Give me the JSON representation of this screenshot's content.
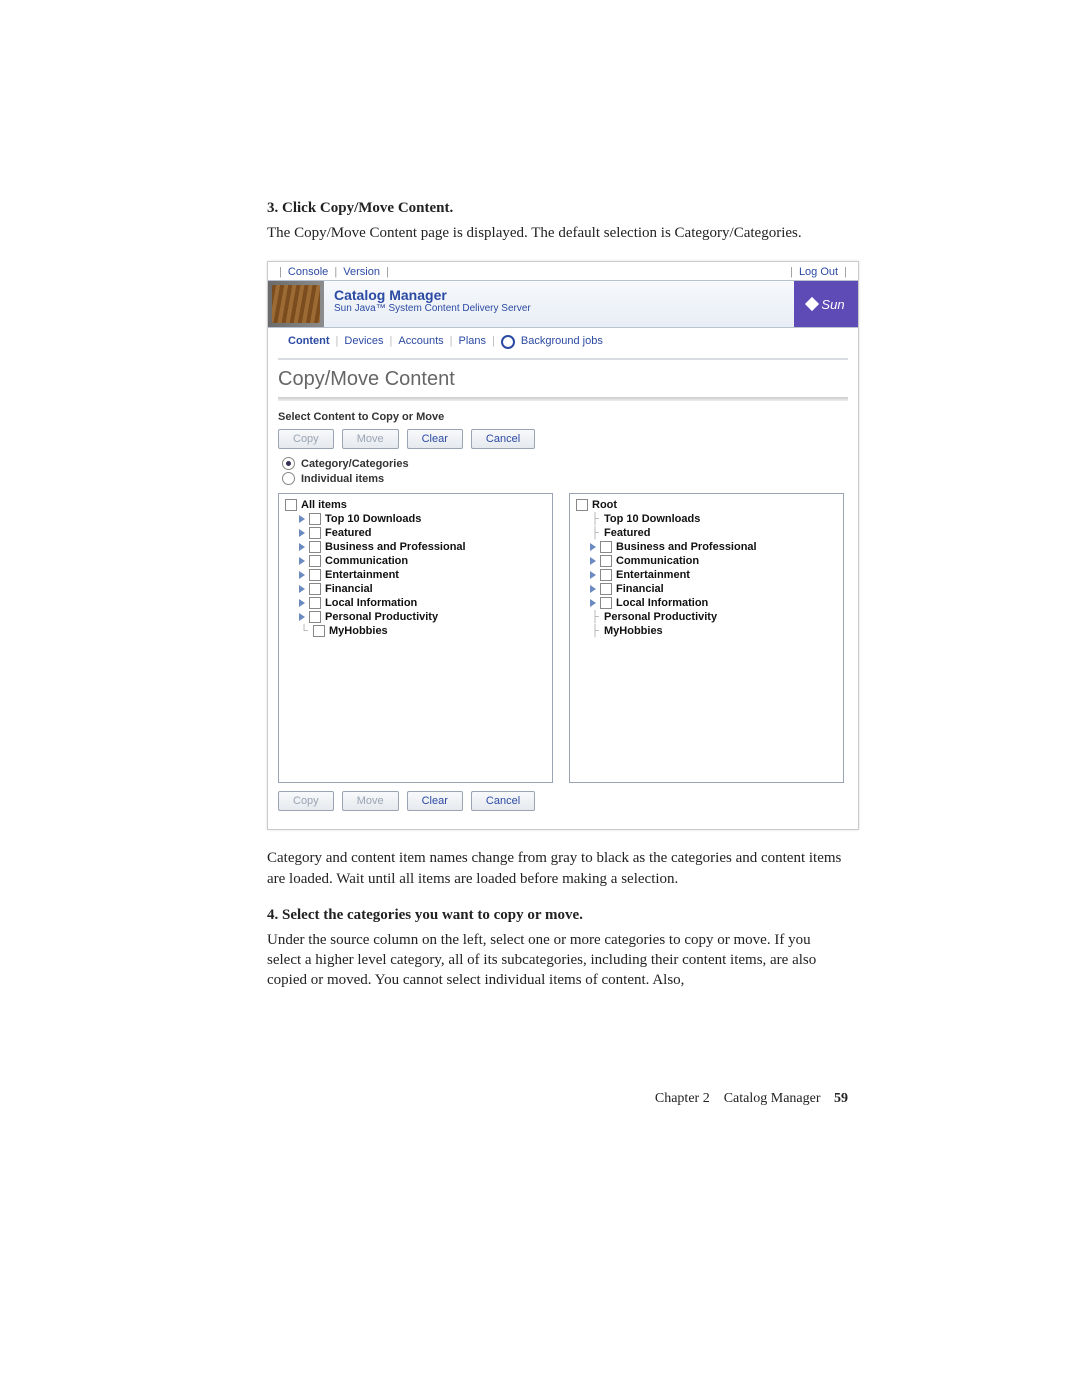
{
  "step3": {
    "num": "3.",
    "title": "Click Copy/Move Content.",
    "body": "The Copy/Move Content page is displayed. The default selection is Category/Categories."
  },
  "screenshot": {
    "topLinks": {
      "console": "Console",
      "version": "Version"
    },
    "logout": "Log Out",
    "headerTitle": "Catalog Manager",
    "headerSub": "Sun Java™ System Content Delivery Server",
    "sunLabel": "Sun",
    "nav": {
      "content": "Content",
      "devices": "Devices",
      "accounts": "Accounts",
      "plans": "Plans",
      "bg": "Background jobs"
    },
    "pageTitle": "Copy/Move Content",
    "sectionLabel": "Select Content to Copy or Move",
    "buttons": {
      "copy": "Copy",
      "move": "Move",
      "clear": "Clear",
      "cancel": "Cancel"
    },
    "radios": {
      "cat": "Category/Categories",
      "ind": "Individual items"
    },
    "leftTree": {
      "root": "All items",
      "items": [
        "Top 10 Downloads",
        "Featured",
        "Business and Professional",
        "Communication",
        "Entertainment",
        "Financial",
        "Local Information",
        "Personal Productivity",
        "MyHobbies"
      ]
    },
    "rightTree": {
      "root": "Root",
      "items": [
        {
          "label": "Top 10 Downloads",
          "expander": false,
          "checkbox": false
        },
        {
          "label": "Featured",
          "expander": false,
          "checkbox": false
        },
        {
          "label": "Business and Professional",
          "expander": true,
          "checkbox": true
        },
        {
          "label": "Communication",
          "expander": true,
          "checkbox": true
        },
        {
          "label": "Entertainment",
          "expander": true,
          "checkbox": true
        },
        {
          "label": "Financial",
          "expander": true,
          "checkbox": true
        },
        {
          "label": "Local Information",
          "expander": true,
          "checkbox": true
        },
        {
          "label": "Personal Productivity",
          "expander": false,
          "checkbox": false
        },
        {
          "label": "MyHobbies",
          "expander": false,
          "checkbox": false
        }
      ]
    }
  },
  "afterText": "Category and content item names change from gray to black as the categories and content items are loaded. Wait until all items are loaded before making a selection.",
  "step4": {
    "num": "4.",
    "title": "Select the categories you want to copy or move.",
    "body": "Under the source column on the left, select one or more categories to copy or move. If you select a higher level category, all of its subcategories, including their content items, are also copied or moved. You cannot select individual items of content. Also,"
  },
  "footer": {
    "chapter": "Chapter 2",
    "title": "Catalog Manager",
    "page": "59"
  }
}
